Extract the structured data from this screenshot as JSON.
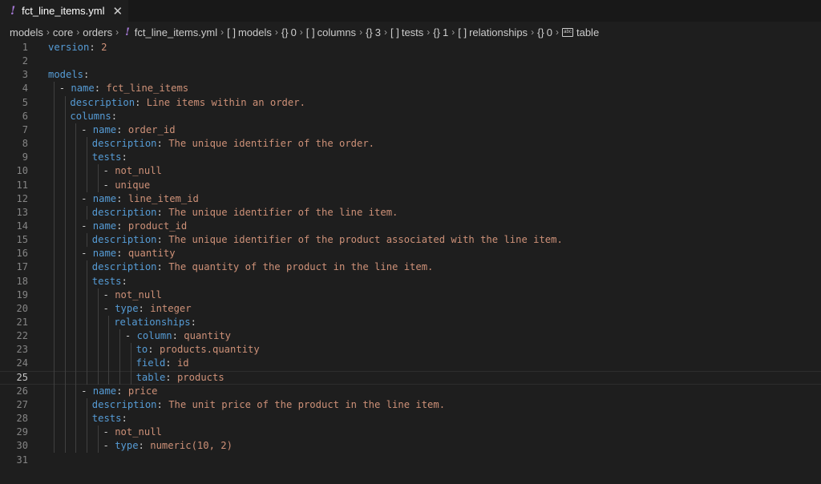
{
  "tab": {
    "filename": "fct_line_items.yml",
    "modified_marker": "!",
    "close_glyph": "✕"
  },
  "breadcrumb": [
    {
      "label": "models",
      "icon": ""
    },
    {
      "label": "core",
      "icon": ""
    },
    {
      "label": "orders",
      "icon": ""
    },
    {
      "label": "fct_line_items.yml",
      "icon": "!"
    },
    {
      "label": "models",
      "icon": "[ ]"
    },
    {
      "label": "0",
      "icon": "{}"
    },
    {
      "label": "columns",
      "icon": "[ ]"
    },
    {
      "label": "3",
      "icon": "{}"
    },
    {
      "label": "tests",
      "icon": "[ ]"
    },
    {
      "label": "1",
      "icon": "{}"
    },
    {
      "label": "relationships",
      "icon": "[ ]"
    },
    {
      "label": "0",
      "icon": "{}"
    },
    {
      "label": "table",
      "icon": "abc"
    }
  ],
  "current_line": 25,
  "lines": [
    {
      "n": "1",
      "indent": 0,
      "dash": false,
      "key": "version",
      "value": "2"
    },
    {
      "n": "2",
      "indent": 0,
      "dash": false,
      "key": "",
      "value": ""
    },
    {
      "n": "3",
      "indent": 0,
      "dash": false,
      "key": "models",
      "value": ""
    },
    {
      "n": "4",
      "indent": 1,
      "dash": true,
      "key": "name",
      "value": "fct_line_items"
    },
    {
      "n": "5",
      "indent": 2,
      "dash": false,
      "key": "description",
      "value": "Line items within an order."
    },
    {
      "n": "6",
      "indent": 2,
      "dash": false,
      "key": "columns",
      "value": ""
    },
    {
      "n": "7",
      "indent": 3,
      "dash": true,
      "key": "name",
      "value": "order_id"
    },
    {
      "n": "8",
      "indent": 4,
      "dash": false,
      "key": "description",
      "value": "The unique identifier of the order."
    },
    {
      "n": "9",
      "indent": 4,
      "dash": false,
      "key": "tests",
      "value": ""
    },
    {
      "n": "10",
      "indent": 5,
      "dash": true,
      "key": "",
      "value": "not_null"
    },
    {
      "n": "11",
      "indent": 5,
      "dash": true,
      "key": "",
      "value": "unique"
    },
    {
      "n": "12",
      "indent": 3,
      "dash": true,
      "key": "name",
      "value": "line_item_id"
    },
    {
      "n": "13",
      "indent": 4,
      "dash": false,
      "key": "description",
      "value": "The unique identifier of the line item."
    },
    {
      "n": "14",
      "indent": 3,
      "dash": true,
      "key": "name",
      "value": "product_id"
    },
    {
      "n": "15",
      "indent": 4,
      "dash": false,
      "key": "description",
      "value": "The unique identifier of the product associated with the line item."
    },
    {
      "n": "16",
      "indent": 3,
      "dash": true,
      "key": "name",
      "value": "quantity"
    },
    {
      "n": "17",
      "indent": 4,
      "dash": false,
      "key": "description",
      "value": "The quantity of the product in the line item."
    },
    {
      "n": "18",
      "indent": 4,
      "dash": false,
      "key": "tests",
      "value": ""
    },
    {
      "n": "19",
      "indent": 5,
      "dash": true,
      "key": "",
      "value": "not_null"
    },
    {
      "n": "20",
      "indent": 5,
      "dash": true,
      "key": "type",
      "value": "integer"
    },
    {
      "n": "21",
      "indent": 6,
      "dash": false,
      "key": "relationships",
      "value": ""
    },
    {
      "n": "22",
      "indent": 7,
      "dash": true,
      "key": "column",
      "value": "quantity"
    },
    {
      "n": "23",
      "indent": 8,
      "dash": false,
      "key": "to",
      "value": "products.quantity"
    },
    {
      "n": "24",
      "indent": 8,
      "dash": false,
      "key": "field",
      "value": "id"
    },
    {
      "n": "25",
      "indent": 8,
      "dash": false,
      "key": "table",
      "value": "products"
    },
    {
      "n": "26",
      "indent": 3,
      "dash": true,
      "key": "name",
      "value": "price"
    },
    {
      "n": "27",
      "indent": 4,
      "dash": false,
      "key": "description",
      "value": "The unit price of the product in the line item."
    },
    {
      "n": "28",
      "indent": 4,
      "dash": false,
      "key": "tests",
      "value": ""
    },
    {
      "n": "29",
      "indent": 5,
      "dash": true,
      "key": "",
      "value": "not_null"
    },
    {
      "n": "30",
      "indent": 5,
      "dash": true,
      "key": "type",
      "value": "numeric(10, 2)"
    },
    {
      "n": "31",
      "indent": 0,
      "dash": false,
      "key": "",
      "value": ""
    }
  ],
  "colors": {
    "key": "#569cd6",
    "value": "#ce9178",
    "background": "#1e1e1e",
    "line_number": "#858585"
  }
}
